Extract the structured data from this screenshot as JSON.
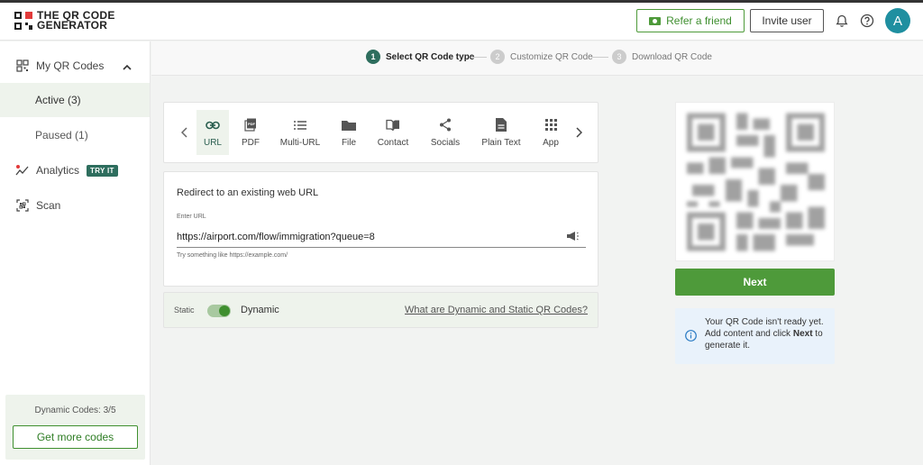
{
  "header": {
    "logo_line1": "THE QR CODE",
    "logo_line2": "GENERATOR",
    "refer_label": "Refer a friend",
    "invite_label": "Invite user",
    "avatar_initial": "A",
    "accent_color": "#4e9a3a",
    "avatar_color": "#1f8fa0"
  },
  "sidebar": {
    "my_qr_codes": "My QR Codes",
    "active": "Active (3)",
    "paused": "Paused (1)",
    "analytics": "Analytics",
    "try_badge": "TRY IT",
    "scan": "Scan",
    "dynamic_codes": "Dynamic Codes: 3/5",
    "get_more": "Get more codes"
  },
  "steps": [
    {
      "num": "1",
      "label": "Select QR Code type",
      "active": true
    },
    {
      "num": "2",
      "label": "Customize QR Code",
      "active": false
    },
    {
      "num": "3",
      "label": "Download QR Code",
      "active": false
    }
  ],
  "types": [
    {
      "label": "URL",
      "icon": "link-icon",
      "selected": true
    },
    {
      "label": "PDF",
      "icon": "pdf-icon",
      "selected": false
    },
    {
      "label": "Multi-URL",
      "icon": "list-icon",
      "selected": false
    },
    {
      "label": "File",
      "icon": "folder-icon",
      "selected": false
    },
    {
      "label": "Contact",
      "icon": "contact-book-icon",
      "selected": false
    },
    {
      "label": "Socials",
      "icon": "share-icon",
      "selected": false
    },
    {
      "label": "Plain Text",
      "icon": "document-icon",
      "selected": false
    },
    {
      "label": "App",
      "icon": "grid-icon",
      "selected": false
    }
  ],
  "url_form": {
    "title": "Redirect to an existing web URL",
    "label": "Enter URL",
    "value": "https://airport.com/flow/immigration?queue=8",
    "helper": "Try something like https://example.com/"
  },
  "toggle": {
    "static_label": "Static",
    "dynamic_label": "Dynamic",
    "is_dynamic": true,
    "help_link": "What are Dynamic and Static QR Codes?"
  },
  "preview": {
    "next_label": "Next",
    "info_before": "Your QR Code isn't ready yet. Add content and click ",
    "info_bold": "Next",
    "info_after": " to generate it."
  }
}
